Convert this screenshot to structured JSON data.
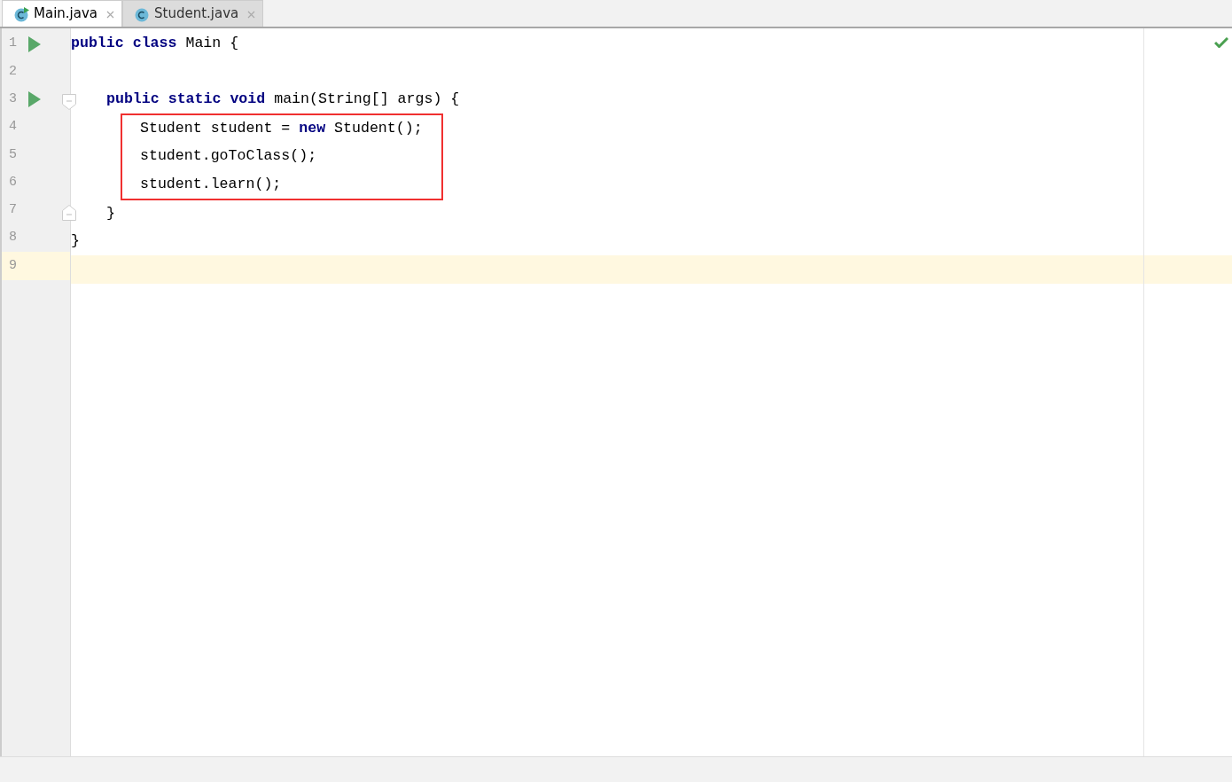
{
  "tabs": [
    {
      "label": "Main.java",
      "selected": true,
      "runnable": true
    },
    {
      "label": "Student.java",
      "selected": false,
      "runnable": false
    }
  ],
  "lines": [
    {
      "number": "1",
      "run": true,
      "tokens": [
        {
          "text": "public class",
          "kind": "keyword"
        },
        {
          "text": " Main {",
          "kind": "plain"
        }
      ],
      "children": [
        {
          "number": "2"
        },
        {
          "number": "3",
          "run": true,
          "fold_open": true,
          "tokens": [
            {
              "text": "public static void",
              "kind": "keyword"
            },
            {
              "text": " main(String[] args) {",
              "kind": "plain"
            }
          ],
          "boxed": true,
          "children": [
            {
              "number": "4",
              "tokens": [
                {
                  "text": "Student student = ",
                  "kind": "plain"
                },
                {
                  "text": "new",
                  "kind": "keyword"
                },
                {
                  "text": " Student();",
                  "kind": "plain"
                }
              ]
            },
            {
              "number": "5",
              "tokens": [
                {
                  "text": "student.goToClass();",
                  "kind": "plain"
                }
              ]
            },
            {
              "number": "6",
              "tokens": [
                {
                  "text": "student.learn();",
                  "kind": "plain"
                }
              ]
            }
          ]
        },
        {
          "number": "7",
          "fold_close": true,
          "tokens": [
            {
              "text": "}",
              "kind": "plain"
            }
          ]
        }
      ]
    },
    {
      "number": "8",
      "tokens": [
        {
          "text": "}",
          "kind": "plain"
        }
      ]
    },
    {
      "number": "9",
      "current": true
    }
  ],
  "analysis_ok": true
}
